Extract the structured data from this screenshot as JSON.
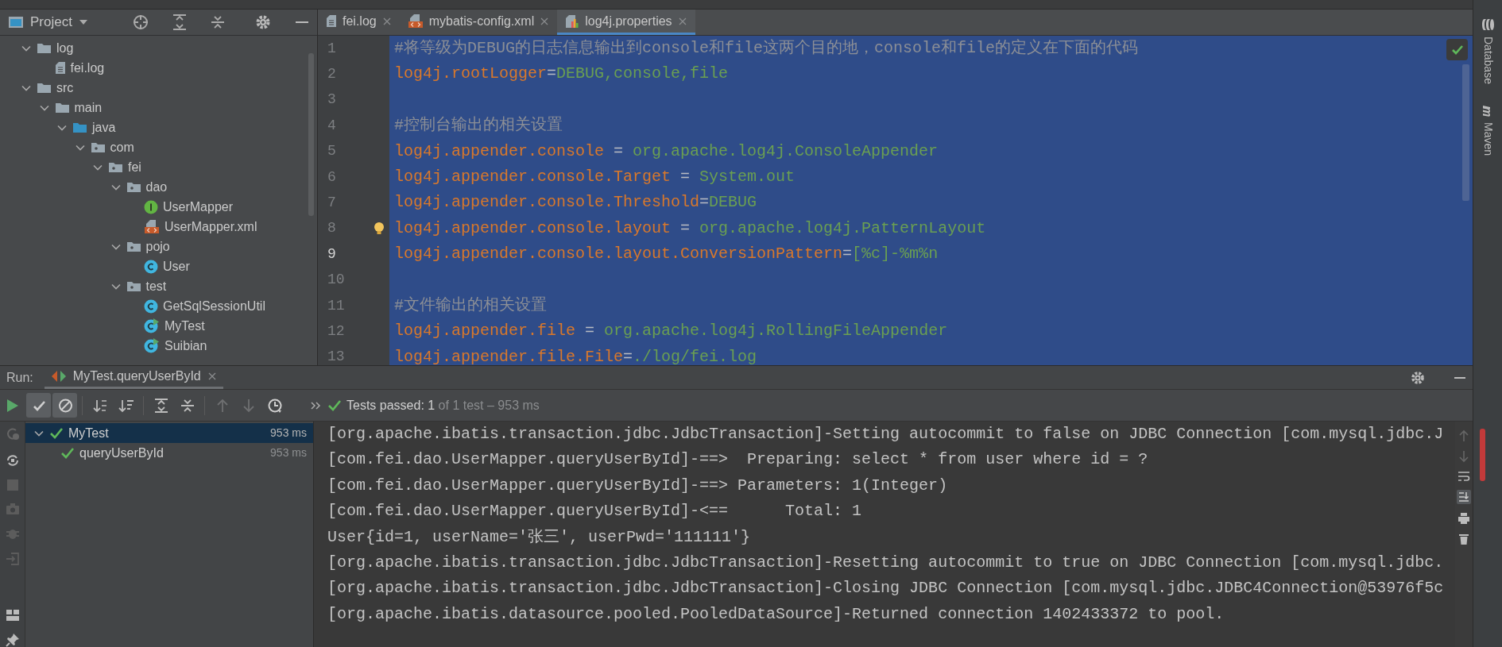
{
  "project_panel": {
    "title": "Project",
    "tree": [
      {
        "label": "log",
        "kind": "folder",
        "expanded": true,
        "children": [
          {
            "label": "fei.log",
            "kind": "text-file"
          }
        ]
      },
      {
        "label": "src",
        "kind": "folder",
        "expanded": true,
        "children": [
          {
            "label": "main",
            "kind": "folder",
            "expanded": true,
            "children": [
              {
                "label": "java",
                "kind": "source-root",
                "expanded": true,
                "children": [
                  {
                    "label": "com",
                    "kind": "package",
                    "expanded": true,
                    "children": [
                      {
                        "label": "fei",
                        "kind": "package",
                        "expanded": true,
                        "children": [
                          {
                            "label": "dao",
                            "kind": "package",
                            "expanded": true,
                            "children": [
                              {
                                "label": "UserMapper",
                                "kind": "interface"
                              },
                              {
                                "label": "UserMapper.xml",
                                "kind": "xml-file"
                              }
                            ]
                          },
                          {
                            "label": "pojo",
                            "kind": "package",
                            "expanded": true,
                            "children": [
                              {
                                "label": "User",
                                "kind": "class"
                              }
                            ]
                          },
                          {
                            "label": "test",
                            "kind": "package",
                            "expanded": true,
                            "children": [
                              {
                                "label": "GetSqlSessionUtil",
                                "kind": "class"
                              },
                              {
                                "label": "MyTest",
                                "kind": "test-class"
                              },
                              {
                                "label": "Suibian",
                                "kind": "test-class"
                              }
                            ]
                          }
                        ]
                      }
                    ]
                  }
                ]
              }
            ]
          }
        ]
      }
    ]
  },
  "editor": {
    "tabs": [
      {
        "label": "fei.log",
        "kind": "text-file",
        "selected": false
      },
      {
        "label": "mybatis-config.xml",
        "kind": "xml-file",
        "selected": false
      },
      {
        "label": "log4j.properties",
        "kind": "properties-file",
        "selected": true
      }
    ],
    "lines": [
      {
        "number": "1",
        "kind": "comment",
        "text": "#将等级为DEBUG的日志信息输出到console和file这两个目的地，console和file的定义在下面的代码",
        "current": false
      },
      {
        "number": "2",
        "kind": "property",
        "key": "log4j.rootLogger",
        "sep": "=",
        "value": "DEBUG,console,file",
        "current": false
      },
      {
        "number": "3",
        "kind": "blank",
        "current": false
      },
      {
        "number": "4",
        "kind": "comment",
        "text": "#控制台输出的相关设置",
        "current": false
      },
      {
        "number": "5",
        "kind": "property",
        "key": "log4j.appender.console",
        "sep": " = ",
        "value": "org.apache.log4j.ConsoleAppender",
        "current": false
      },
      {
        "number": "6",
        "kind": "property",
        "key": "log4j.appender.console.Target",
        "sep": " = ",
        "value": "System.out",
        "current": false
      },
      {
        "number": "7",
        "kind": "property",
        "key": "log4j.appender.console.Threshold",
        "sep": "=",
        "value": "DEBUG",
        "current": false
      },
      {
        "number": "8",
        "kind": "property",
        "key": "log4j.appender.console.layout",
        "sep": " = ",
        "value": "org.apache.log4j.PatternLayout",
        "current": false,
        "bulb": true
      },
      {
        "number": "9",
        "kind": "property",
        "key": "log4j.appender.console.layout.ConversionPattern",
        "sep": "=",
        "value": "[%c]-%m%n",
        "current": true
      },
      {
        "number": "10",
        "kind": "blank",
        "current": false
      },
      {
        "number": "11",
        "kind": "comment",
        "text": "#文件输出的相关设置",
        "current": false
      },
      {
        "number": "12",
        "kind": "property",
        "key": "log4j.appender.file",
        "sep": " = ",
        "value": "org.apache.log4j.RollingFileAppender",
        "current": false
      },
      {
        "number": "13",
        "kind": "property",
        "key": "log4j.appender.file.File",
        "sep": "=",
        "value": "./log/fei.log",
        "current": false
      }
    ]
  },
  "right_sidebar": [
    {
      "label": "Database",
      "kind": "database"
    },
    {
      "label": "Maven",
      "kind": "maven"
    }
  ],
  "run_panel": {
    "label": "Run:",
    "tab": {
      "label": "MyTest.queryUserById",
      "selected": true
    },
    "toolbar": [
      {
        "kind": "show-passed",
        "on": true,
        "disabled": false
      },
      {
        "kind": "show-ignored",
        "on": true,
        "disabled": false
      },
      {
        "kind": "sort-alpha",
        "on": false,
        "disabled": false
      },
      {
        "kind": "sort-duration",
        "on": false,
        "disabled": false
      },
      {
        "kind": "expand-all",
        "on": false,
        "disabled": false
      },
      {
        "kind": "collapse-all",
        "on": false,
        "disabled": false
      },
      {
        "kind": "prev",
        "disabled": true
      },
      {
        "kind": "next",
        "disabled": true
      },
      {
        "kind": "history",
        "on": false,
        "disabled": false
      }
    ],
    "status": {
      "passed": "Tests passed: 1",
      "detail": " of 1 test – 953 ms"
    },
    "tests": [
      {
        "name": "MyTest",
        "time": "953 ms",
        "passed": true,
        "selected": true,
        "expanded": true,
        "children": [
          {
            "name": "queryUserById",
            "time": "953 ms",
            "passed": true,
            "selected": false
          }
        ]
      }
    ],
    "console": [
      "[org.apache.ibatis.transaction.jdbc.JdbcTransaction]-Setting autocommit to false on JDBC Connection [com.mysql.jdbc.J",
      "[com.fei.dao.UserMapper.queryUserById]-==>  Preparing: select * from user where id = ?",
      "[com.fei.dao.UserMapper.queryUserById]-==> Parameters: 1(Integer)",
      "[com.fei.dao.UserMapper.queryUserById]-<==      Total: 1",
      "User{id=1, userName='张三', userPwd='111111'}",
      "[org.apache.ibatis.transaction.jdbc.JdbcTransaction]-Resetting autocommit to true on JDBC Connection [com.mysql.jdbc.",
      "[org.apache.ibatis.transaction.jdbc.JdbcTransaction]-Closing JDBC Connection [com.mysql.jdbc.JDBC4Connection@53976f5c",
      "[org.apache.ibatis.datasource.pooled.PooledDataSource]-Returned connection 1402433372 to pool."
    ]
  }
}
